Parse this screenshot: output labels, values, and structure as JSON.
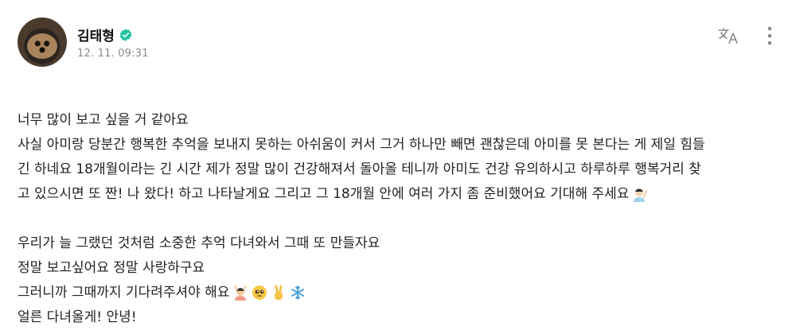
{
  "post": {
    "author_name": "김태형",
    "timestamp": "12. 11. 09:31",
    "paragraph1": [
      "너무 많이 보고 싶을 거 같아요",
      "사실 아미랑 당분간 행복한 추억을 보내지 못하는 아쉬움이 커서 그거 하나만 빼면 괜찮은데 아미를 못 본다는 게 제일 힘들",
      "긴 하네요 18개월이라는 긴 시간 제가 정말 많이 건강해져서 돌아올 테니까 아미도 건강 유의하시고 하루하루 행복거리 찾",
      "고 있으시면 또 짠! 나 왔다! 하고 나타날게요 그리고 그 18개월 안에 여러 가지 좀 준비했어요 기대해 주세요"
    ],
    "paragraph2": [
      "우리가 늘 그랬던 것처럼 소중한 추억 다녀와서 그때 또 만들자요",
      "정말 보고싶어요 정말 사랑하구요",
      "그러니까 그때까지 기다려주셔야 해요",
      "얼른 다녀올게! 안녕!"
    ]
  },
  "icons": {
    "verified": "verified-badge-icon",
    "translate": "translate-icon",
    "more": "more-vertical-icon"
  },
  "colors": {
    "verified": "#1fc2a0",
    "icon_gray": "#8a8a8a"
  }
}
